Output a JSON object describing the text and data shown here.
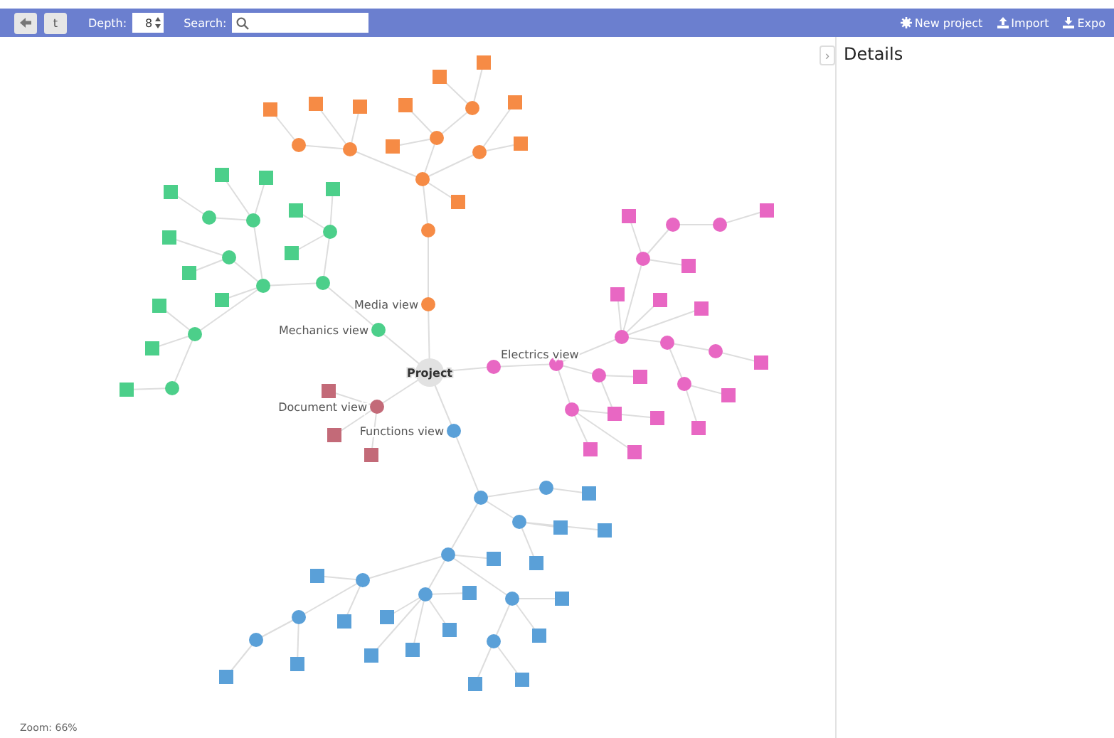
{
  "toolbar": {
    "buttons": [
      {
        "kind": "back"
      },
      {
        "kind": "text",
        "label": "t"
      }
    ],
    "depth_label": "Depth:",
    "depth": "8",
    "search_label": "Search:",
    "actions": [
      {
        "kind": "gear",
        "label": "New project"
      },
      {
        "kind": "upload",
        "label": "Import"
      },
      {
        "kind": "download",
        "label": "Expo"
      }
    ]
  },
  "graph": {
    "root": "Project",
    "branches": [
      {
        "label": "Media view",
        "color": "#f68b45"
      },
      {
        "label": "Mechanics view",
        "color": "#4ccf8a"
      },
      {
        "label": "Electrics view",
        "color": "#e867c3"
      },
      {
        "label": "Functions view",
        "color": "#5aa0d8"
      },
      {
        "label": "Document view",
        "color": "#c36a78"
      }
    ]
  },
  "zoom": "Zoom: 66%",
  "details": {
    "title": "Details",
    "toggle": "›"
  }
}
